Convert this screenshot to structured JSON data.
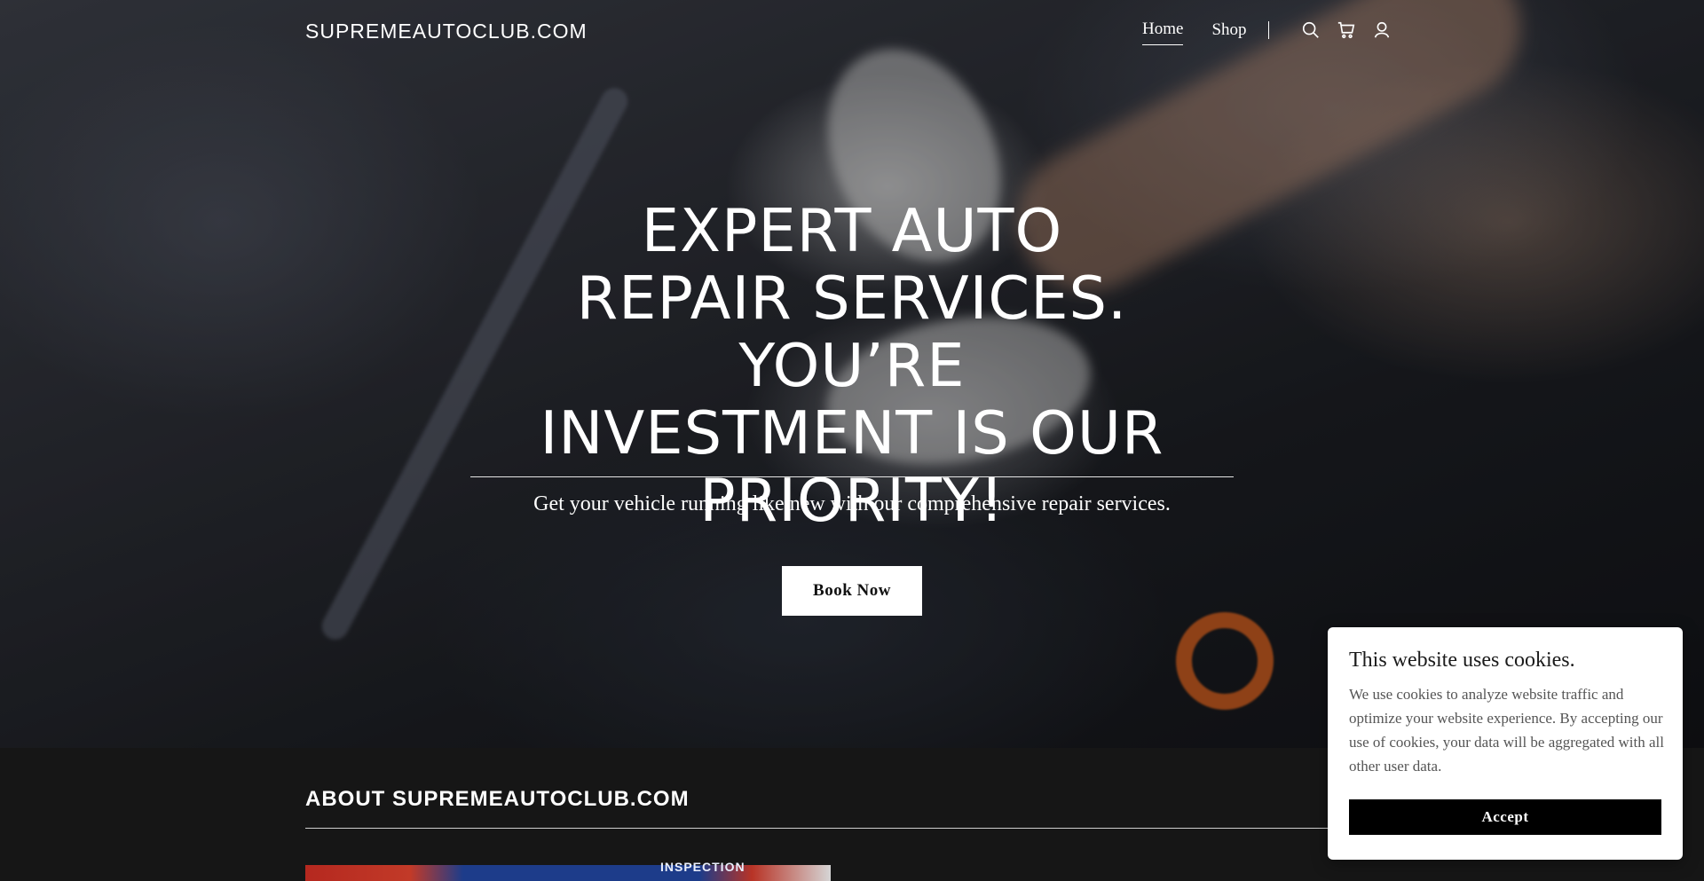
{
  "header": {
    "site_name": "SUPREMEAUTOCLUB.COM",
    "nav": [
      {
        "label": "Home",
        "active": true
      },
      {
        "label": "Shop",
        "active": false
      }
    ],
    "icons": [
      "search-icon",
      "cart-icon",
      "account-icon"
    ]
  },
  "hero": {
    "title": "EXPERT AUTO REPAIR SERVICES. YOU’RE INVESTMENT IS OUR PRIORITY!",
    "subtitle": "Get your vehicle running like new with our comprehensive repair services.",
    "cta_label": "Book Now"
  },
  "about": {
    "title": "ABOUT SUPREMEAUTOCLUB.COM",
    "image_sign_text": "INSPECTION"
  },
  "cookie_banner": {
    "title": "This website uses cookies.",
    "text": "We use cookies to analyze website traffic and optimize your website experience. By accepting our use of cookies, your data will be aggregated with all other user data.",
    "accept_label": "Accept"
  },
  "colors": {
    "footer_bg": "#161616",
    "button_bg": "#ffffff",
    "accept_bg": "#000000"
  }
}
